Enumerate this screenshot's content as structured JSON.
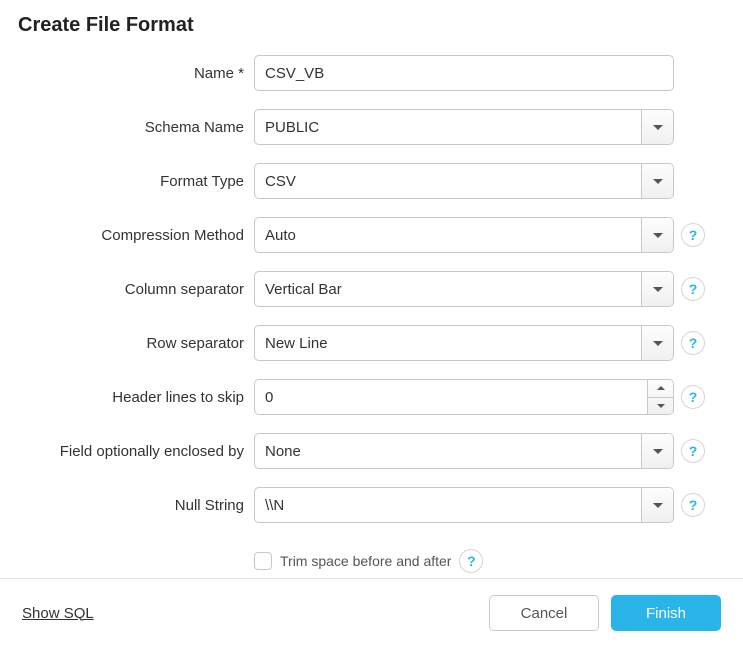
{
  "dialog": {
    "title": "Create File Format"
  },
  "fields": {
    "name": {
      "label": "Name *",
      "value": "CSV_VB"
    },
    "schema": {
      "label": "Schema Name",
      "value": "PUBLIC"
    },
    "format_type": {
      "label": "Format Type",
      "value": "CSV"
    },
    "compression": {
      "label": "Compression Method",
      "value": "Auto"
    },
    "col_sep": {
      "label": "Column separator",
      "value": "Vertical Bar"
    },
    "row_sep": {
      "label": "Row separator",
      "value": "New Line"
    },
    "header_skip": {
      "label": "Header lines to skip",
      "value": "0"
    },
    "enclosed_by": {
      "label": "Field optionally enclosed by",
      "value": "None"
    },
    "null_string": {
      "label": "Null String",
      "value": "\\\\N"
    },
    "trim": {
      "label": "Trim space before and after",
      "checked": false
    }
  },
  "footer": {
    "show_sql": "Show SQL",
    "cancel": "Cancel",
    "finish": "Finish"
  },
  "help_glyph": "?"
}
